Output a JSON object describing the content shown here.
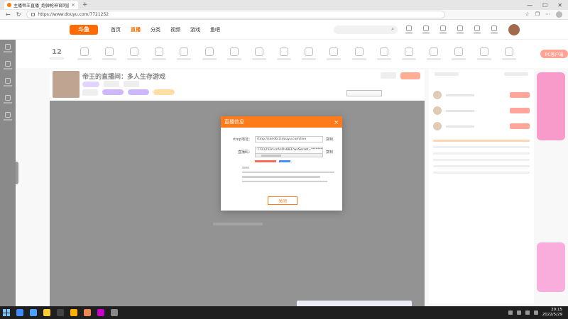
{
  "browser": {
    "tab_title": "主播帝王直播_炮弹枪神官网直播...",
    "url": "https://www.douyu.com/7721252"
  },
  "site": {
    "logo": "斗鱼",
    "nav": [
      "首页",
      "直播",
      "分类",
      "视频",
      "游戏",
      "鱼吧"
    ],
    "active_nav": "直播",
    "search_icon": "search-icon"
  },
  "category_bar": {
    "count": "12",
    "badge": "PC客户端"
  },
  "room": {
    "title": "帝王的直播间：多人生存游戏"
  },
  "modal": {
    "title": "直播信息",
    "close": "×",
    "rtmp_label": "rtmp地址：",
    "rtmp_value": "rtmp://sendtc3.douyu.com/live",
    "copy1": "复制",
    "key_label": "直播码：",
    "key_value": "7721252rLcrAnOv883?wsSecret=**********",
    "copy2": "复制",
    "ok": "关闭"
  },
  "taskbar": {
    "time": "20:15",
    "date": "2022/5/29"
  },
  "colors": {
    "accent": "#ff7a1a",
    "brand": "#ff6b00"
  }
}
